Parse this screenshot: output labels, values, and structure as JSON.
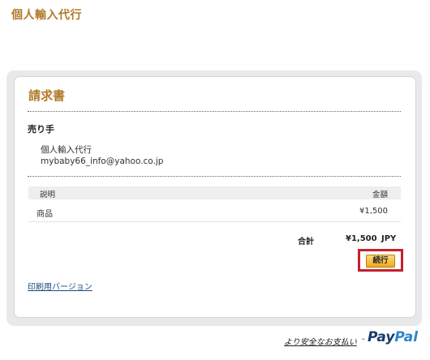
{
  "header": {
    "site_title": "個人輸入代行"
  },
  "invoice": {
    "title": "請求書",
    "seller_heading": "売り手",
    "seller_name": "個人輸入代行",
    "seller_email": "mybaby66_info@yahoo.co.jp",
    "table": {
      "col_description": "説明",
      "col_amount": "金額",
      "items": [
        {
          "name": "商品",
          "amount": "¥1,500"
        }
      ]
    },
    "total_label": "合計",
    "total_value": "¥1,500",
    "total_currency": "JPY",
    "continue_label": "続行",
    "print_link": "印刷用バージョン"
  },
  "footer": {
    "safer_text": "より安全なお支払い",
    "dash": "-",
    "paypal_pay": "Pay",
    "paypal_pal": "Pal"
  },
  "colors": {
    "accent": "#b27a2a",
    "highlight_border": "#c4202c",
    "link": "#1a4b7a"
  }
}
